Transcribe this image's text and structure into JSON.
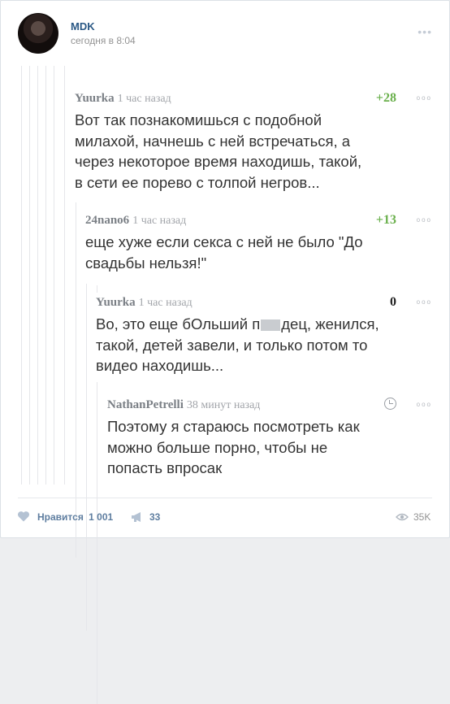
{
  "post": {
    "author": "MDK",
    "time": "сегодня в 8:04",
    "more": "•••"
  },
  "comments": [
    {
      "name": "Yuurka",
      "time": "1 час назад",
      "score": "+28",
      "dots": "ooo",
      "lines": [
        "Вот так познакомишься с подобной",
        "милахой, начнешь с ней встречаться, а",
        "через некоторое время находишь, такой,",
        "в сети ее порево с толпой негров..."
      ]
    },
    {
      "name": "24nano6",
      "time": "1 час назад",
      "score": "+13",
      "dots": "ooo",
      "lines": [
        "еще хуже если секса  с ней не было \"До",
        "свадьбы нельзя!\""
      ]
    },
    {
      "name": "Yuurka",
      "time": "1 час назад",
      "score": "0",
      "dots": "ooo",
      "line1_pre": "Во, это еще бОльший п",
      "line1_post": "дец, женился,",
      "lines": [
        "такой, детей завели, и только потом то",
        "видео находишь..."
      ]
    },
    {
      "name": "NathanPetrelli",
      "time": "38 минут назад",
      "dots": "ooo",
      "lines": [
        "Поэтому я стараюсь посмотреть как",
        "можно больше порно, чтобы не",
        "попасть впросак"
      ]
    }
  ],
  "footer": {
    "likes_label": "Нравится",
    "likes_count": "1 001",
    "shares_count": "33",
    "views_count": "35K"
  }
}
